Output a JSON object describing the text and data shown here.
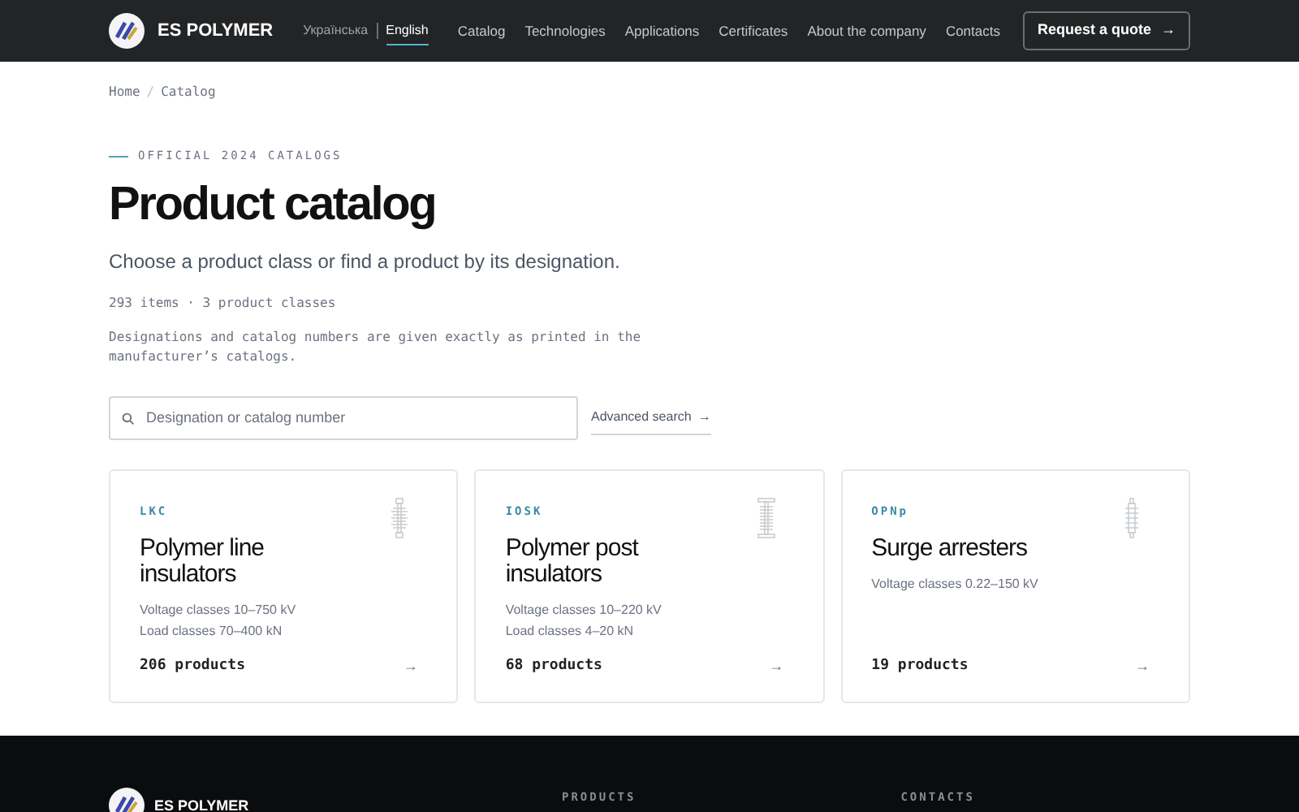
{
  "header": {
    "logo_text": "ES POLYMER",
    "languages": [
      {
        "label": "Українська",
        "selected": false
      },
      {
        "label": "English",
        "selected": true
      }
    ],
    "nav": [
      "Catalog",
      "Technologies",
      "Applications",
      "Certificates",
      "About the company",
      "Contacts"
    ],
    "cta": {
      "label": "Request a quote",
      "icon": "→"
    }
  },
  "breadcrumbs": [
    "Home",
    "Catalog"
  ],
  "breadcrumb_separator": "/",
  "eyebrow": "OFFICIAL 2024 CATALOGS",
  "title": "Product catalog",
  "subtitle": "Choose a product class or find a product by its designation.",
  "stats": "293 items · 3 product classes",
  "note": "Designations and catalog numbers are given exactly as printed in the manufacturer’s catalogs.",
  "search": {
    "placeholder": "Designation or catalog number",
    "advanced": "Advanced search",
    "advanced_icon": "→"
  },
  "cards": [
    {
      "code": "LKC",
      "title": "Polymer line insulators",
      "specs": [
        "Voltage classes 10–750 kV",
        "Load classes 70–400 kN"
      ],
      "count": "206 products",
      "arrow": "→",
      "kind": "line"
    },
    {
      "code": "IOSK",
      "title": "Polymer post insulators",
      "specs": [
        "Voltage classes 10–220 kV",
        "Load classes 4–20 kN"
      ],
      "count": "68 products",
      "arrow": "→",
      "kind": "post"
    },
    {
      "code": "OPNp",
      "title": "Surge arresters",
      "specs": [
        "Voltage classes 0.22–150 kV"
      ],
      "count": "19 products",
      "arrow": "→",
      "kind": "arrester"
    }
  ],
  "footer": {
    "logo_text": "ES POLYMER",
    "headings": [
      "PRODUCTS",
      "CONTACTS"
    ]
  }
}
